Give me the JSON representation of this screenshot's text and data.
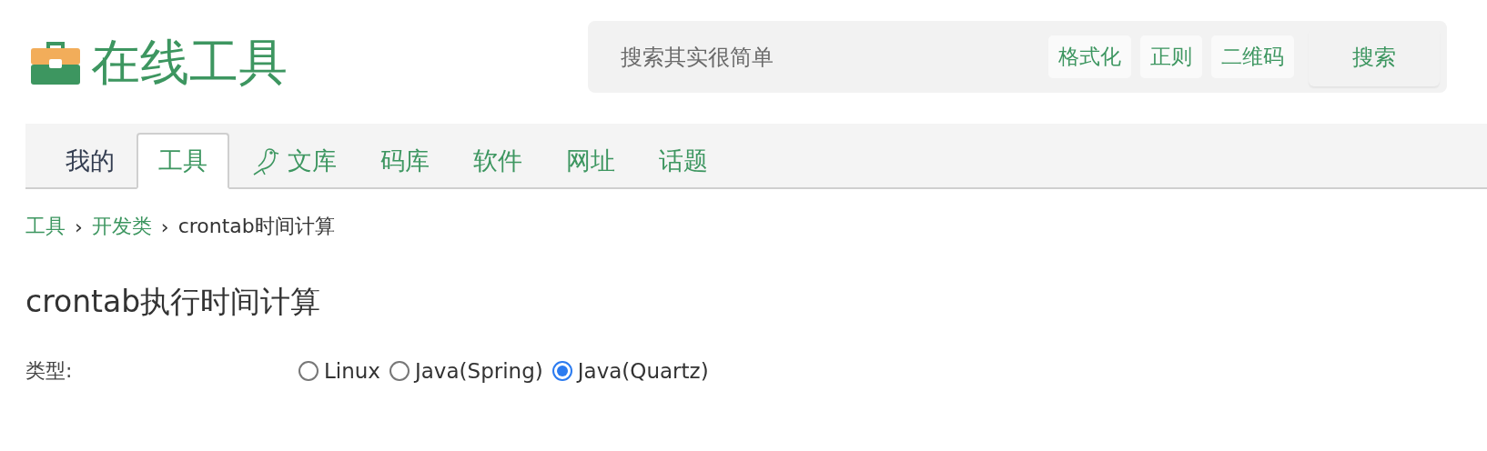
{
  "logo": {
    "title": "在线工具"
  },
  "search": {
    "placeholder": "搜索其实很简单",
    "shortcuts": [
      "格式化",
      "正则",
      "二维码"
    ],
    "button": "搜索"
  },
  "tabs": [
    {
      "label": "我的",
      "selected": false,
      "kind": "text",
      "color": "#333d50"
    },
    {
      "label": "工具",
      "selected": true,
      "kind": "text",
      "color": "#3d9660"
    },
    {
      "label": "文库",
      "selected": false,
      "kind": "bird",
      "color": "#3d9660"
    },
    {
      "label": "码库",
      "selected": false,
      "kind": "text",
      "color": "#3d9660"
    },
    {
      "label": "软件",
      "selected": false,
      "kind": "text",
      "color": "#3d9660"
    },
    {
      "label": "网址",
      "selected": false,
      "kind": "text",
      "color": "#3d9660"
    },
    {
      "label": "话题",
      "selected": false,
      "kind": "text",
      "color": "#3d9660"
    }
  ],
  "breadcrumb": {
    "links": [
      "工具",
      "开发类"
    ],
    "separator": "›",
    "current": "crontab时间计算"
  },
  "heading": "crontab执行时间计算",
  "type_field": {
    "label": "类型:",
    "options": [
      {
        "label": "Linux",
        "selected": false
      },
      {
        "label": "Java(Spring)",
        "selected": false
      },
      {
        "label": "Java(Quartz)",
        "selected": true
      }
    ]
  }
}
